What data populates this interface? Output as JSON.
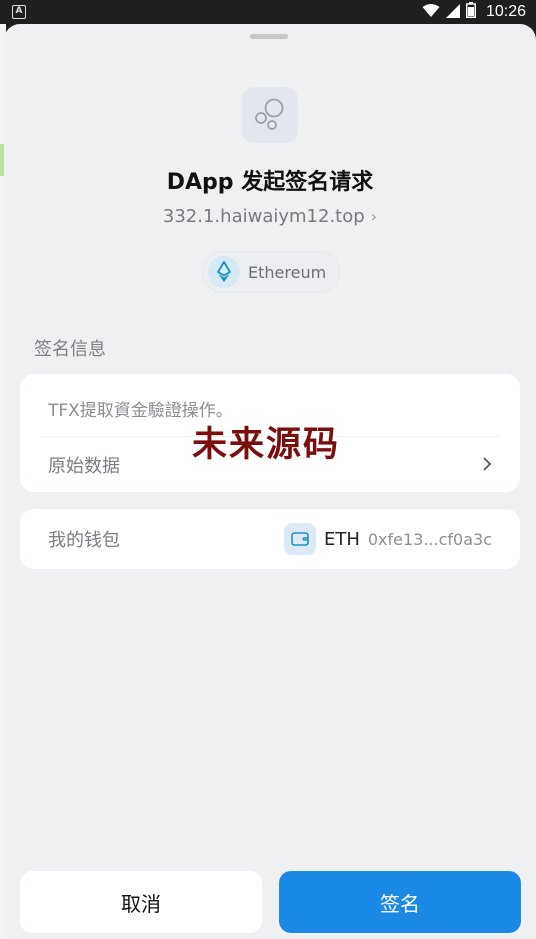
{
  "status_bar": {
    "app_badge": "A",
    "time": "10:26"
  },
  "dialog": {
    "title": "DApp 发起签名请求",
    "origin_url": "332.1.haiwaiym12.top",
    "origin_chevron": "›",
    "chain": {
      "name": "Ethereum",
      "icon": "ethereum-icon",
      "color": "#1c8fc4"
    },
    "section_label": "签名信息",
    "message": "TFX提取資金驗證操作。",
    "raw_data_label": "原始数据",
    "raw_data_chevron": "›",
    "watermark": "未来源码",
    "wallet": {
      "label": "我的钱包",
      "coin": "ETH",
      "address": "0xfe13...cf0a3c",
      "icon": "wallet-icon"
    },
    "buttons": {
      "cancel": "取消",
      "sign": "签名"
    }
  },
  "colors": {
    "accent": "#1b8ae6",
    "sheet_bg": "#eff0f2",
    "watermark": "#7a0e0e"
  }
}
